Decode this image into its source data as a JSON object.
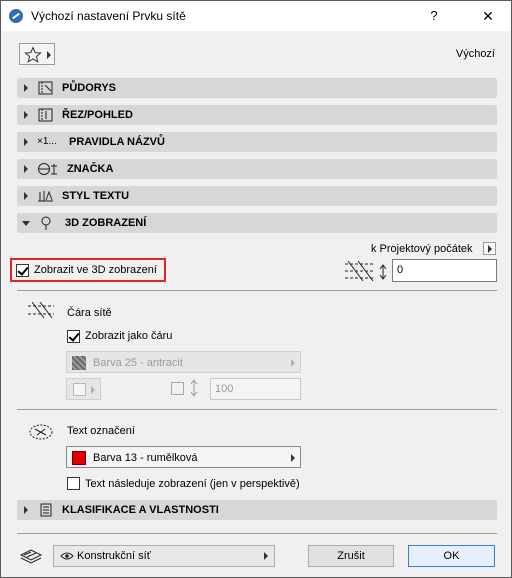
{
  "window": {
    "title": "Výchozí nastavení Prvku sítě",
    "help_label": "?",
    "close_label": "✕"
  },
  "favorites": {
    "icon": "star-icon"
  },
  "preset": {
    "label": "Výchozí"
  },
  "sections": [
    {
      "label": "PŮDORYS",
      "icon": "floor-plan-icon",
      "expanded": false
    },
    {
      "label": "ŘEZ/POHLED",
      "icon": "section-view-icon",
      "expanded": false
    },
    {
      "label": "PRAVIDLA NÁZVŮ",
      "icon": "naming-rules-icon",
      "prefix": "×1...",
      "expanded": false
    },
    {
      "label": "ZNAČKA",
      "icon": "marker-icon",
      "expanded": false
    },
    {
      "label": "STYL TEXTU",
      "icon": "text-style-icon",
      "expanded": false
    },
    {
      "label": "3D ZOBRAZENÍ",
      "icon": "3d-pin-icon",
      "expanded": true
    },
    {
      "label": "KLASIFIKACE A VLASTNOSTI",
      "icon": "classification-icon",
      "expanded": false
    }
  ],
  "view3d": {
    "origin_link": "k Projektový počátek",
    "show_in_3d_label": "Zobrazit ve 3D zobrazení",
    "show_in_3d_checked": true,
    "elevation_value": "0",
    "grid_line": {
      "heading": "Čára sítě",
      "show_as_line_label": "Zobrazit jako čáru",
      "show_as_line_checked": true,
      "pen_label": "Barva 25 - antracit",
      "pen_color": "#3a3a3a",
      "thickness_value": "100"
    },
    "marker_text": {
      "heading": "Text označení",
      "pen_label": "Barva 13 - rumělková",
      "pen_color": "#e00000",
      "follow_label": "Text následuje zobrazení (jen v perspektivě)",
      "follow_checked": false
    }
  },
  "footer": {
    "layer_label": "Konstrukční síť",
    "cancel_label": "Zrušit",
    "ok_label": "OK"
  }
}
